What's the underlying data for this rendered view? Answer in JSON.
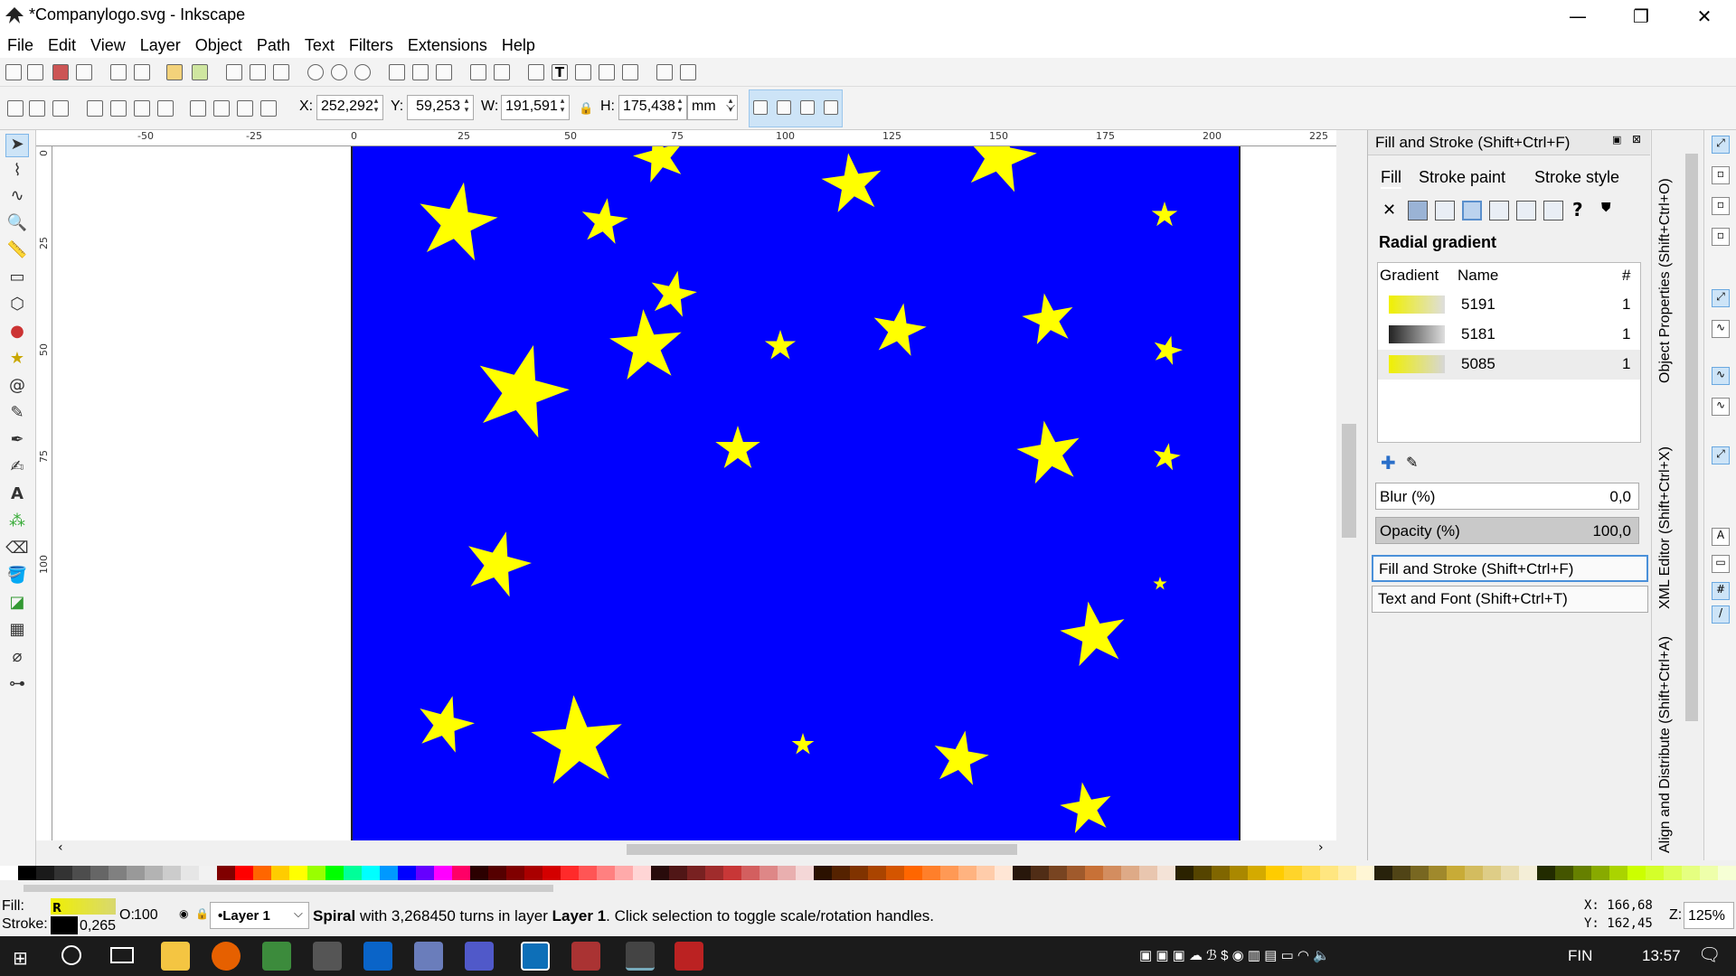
{
  "window": {
    "title": "*Companylogo.svg - Inkscape",
    "minimize": "—",
    "maximize": "❐",
    "close": "✕"
  },
  "menu": [
    "File",
    "Edit",
    "View",
    "Layer",
    "Object",
    "Path",
    "Text",
    "Filters",
    "Extensions",
    "Help"
  ],
  "toolcontrols": {
    "x_label": "X:",
    "x_value": "252,292",
    "y_label": "Y:",
    "y_value": "59,253",
    "w_label": "W:",
    "w_value": "191,591",
    "h_label": "H:",
    "h_value": "175,438",
    "unit": "mm"
  },
  "ruler": {
    "h_ticks": [
      "-50",
      "-25",
      "0",
      "25",
      "50",
      "75",
      "100",
      "125",
      "150",
      "175",
      "200",
      "225"
    ],
    "v_ticks": [
      "0",
      "25",
      "50",
      "75",
      "100"
    ]
  },
  "dock": {
    "title": "Fill and Stroke (Shift+Ctrl+F)",
    "tabs": {
      "fill": "Fill",
      "stroke_paint": "Stroke paint",
      "stroke_style": "Stroke style"
    },
    "gradient_type": "Radial gradient",
    "table_headers": {
      "gradient": "Gradient",
      "name": "Name",
      "count": "#"
    },
    "gradients": [
      {
        "name": "5191",
        "count": "1",
        "color": "#f0f000"
      },
      {
        "name": "5181",
        "count": "1",
        "color": "#222222"
      },
      {
        "name": "5085",
        "count": "1",
        "color": "#f0f000"
      }
    ],
    "blur_label": "Blur (%)",
    "blur_value": "0,0",
    "opacity_label": "Opacity (%)",
    "opacity_value": "100,0",
    "panel_fill_stroke": "Fill and Stroke (Shift+Ctrl+F)",
    "panel_text_font": "Text and Font (Shift+Ctrl+T)",
    "vtabs": [
      "Object Properties (Shift+Ctrl+O)",
      "XML Editor (Shift+Ctrl+X)",
      "Align and Distribute (Shift+Ctrl+A)"
    ]
  },
  "status": {
    "fill_label": "Fill:",
    "stroke_label": "Stroke:",
    "fill_type": "R",
    "stroke_width": "0,265",
    "opacity_label": "O:",
    "opacity_value": "100",
    "layer": "•Layer 1",
    "message_bold": "Spiral",
    "message_rest": " with 3,268450 turns in layer ",
    "message_layer": "Layer 1",
    "message_end": ". Click selection to toggle scale/rotation handles.",
    "x_coord": "X:  166,68",
    "y_coord": "Y:  162,45",
    "zoom_label": "Z:",
    "zoom_value": "125%"
  },
  "taskbar": {
    "language": "FIN",
    "time": "13:57"
  },
  "colors": {
    "page": "#0000ff",
    "star": "#ffff00",
    "accent": "#cde4f7"
  }
}
